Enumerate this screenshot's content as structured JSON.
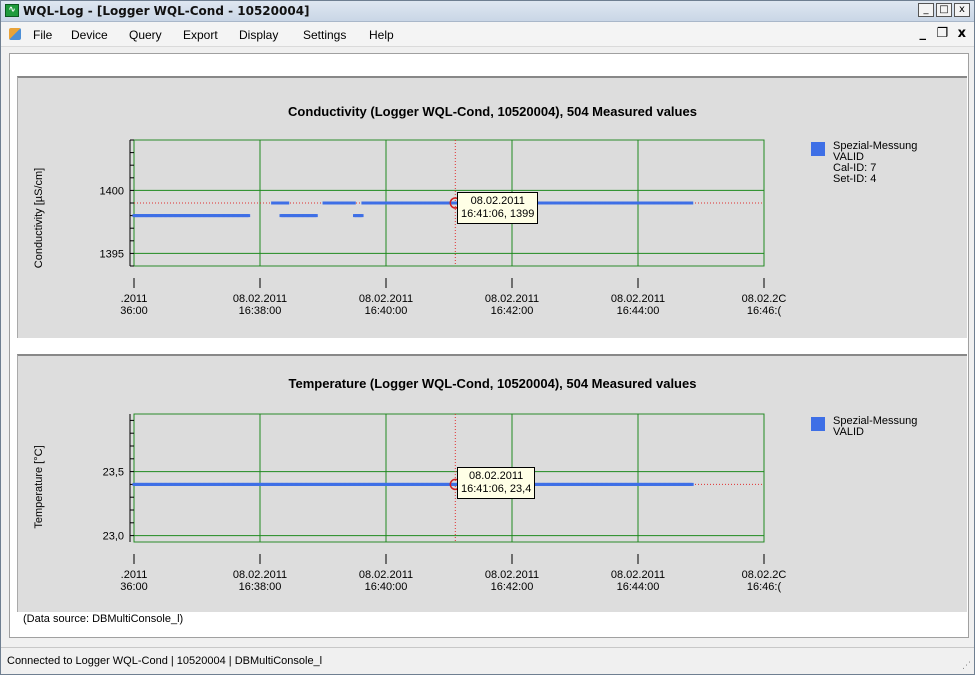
{
  "window": {
    "title": "WQL-Log - [Logger WQL-Cond - 10520004]",
    "controls": {
      "minimize": "_",
      "maximize": "□",
      "close": "x"
    },
    "mdi_controls": {
      "minimize": "_",
      "restore": "❐",
      "close": "x"
    }
  },
  "menu": {
    "items": [
      "File",
      "Device",
      "Query",
      "Export",
      "Display",
      "Settings",
      "Help"
    ]
  },
  "charts": [
    {
      "title": "Conductivity (Logger WQL-Cond, 10520004), 504 Measured values",
      "ylabel": "Conductivity [µS/cm]",
      "y_ticks": [
        "1400",
        "1395"
      ],
      "legend": {
        "name": "Spezial-Messung",
        "lines": [
          "VALID",
          "Cal-ID: 7",
          "Set-ID: 4"
        ]
      },
      "tooltip": {
        "line1": "08.02.2011",
        "line2": "16:41:06, 1399"
      }
    },
    {
      "title": "Temperature (Logger WQL-Cond, 10520004), 504 Measured values",
      "ylabel": "Temperature [°C]",
      "y_ticks": [
        "23,5",
        "23,0"
      ],
      "legend": {
        "name": "Spezial-Messung",
        "lines": [
          "VALID"
        ]
      },
      "tooltip": {
        "line1": "08.02.2011",
        "line2": "16:41:06, 23,4"
      }
    }
  ],
  "x_ticks": [
    {
      "date": ".2011",
      "time": "36:00"
    },
    {
      "date": "08.02.2011",
      "time": "16:38:00"
    },
    {
      "date": "08.02.2011",
      "time": "16:40:00"
    },
    {
      "date": "08.02.2011",
      "time": "16:42:00"
    },
    {
      "date": "08.02.2011",
      "time": "16:44:00"
    },
    {
      "date": "08.02.2C",
      "time": "16:46:("
    }
  ],
  "chart_data": [
    {
      "type": "scatter",
      "title": "Conductivity (Logger WQL-Cond, 10520004), 504 Measured values",
      "ylabel": "Conductivity [µS/cm]",
      "ylim": [
        1394,
        1404
      ],
      "x_range": [
        "16:36:00",
        "16:46:00"
      ],
      "series": [
        {
          "name": "Spezial-Messung",
          "color": "#3e6fe6",
          "segments": [
            {
              "from": "16:36:00",
              "to": "16:37:50",
              "y": 1398
            },
            {
              "from": "16:38:12",
              "to": "16:38:27",
              "y": 1399
            },
            {
              "from": "16:38:20",
              "to": "16:38:54",
              "y": 1398
            },
            {
              "from": "16:39:01",
              "to": "16:39:30",
              "y": 1399
            },
            {
              "from": "16:39:30",
              "to": "16:39:38",
              "y": 1398
            },
            {
              "from": "16:39:38",
              "to": "16:44:52",
              "y": 1399
            }
          ]
        }
      ],
      "cursor": {
        "x": "16:41:06",
        "y": 1399
      },
      "grid": true
    },
    {
      "type": "scatter",
      "title": "Temperature (Logger WQL-Cond, 10520004), 504 Measured values",
      "ylabel": "Temperature [°C]",
      "ylim": [
        22.95,
        23.95
      ],
      "x_range": [
        "16:36:00",
        "16:46:00"
      ],
      "series": [
        {
          "name": "Spezial-Messung",
          "color": "#3e6fe6",
          "segments": [
            {
              "from": "16:36:00",
              "to": "16:44:52",
              "y": 23.4
            }
          ]
        }
      ],
      "cursor": {
        "x": "16:41:06",
        "y": 23.4
      },
      "grid": true
    }
  ],
  "footer": {
    "datasource": "(Data source: DBMultiConsole_l)",
    "status": "Connected to Logger WQL-Cond  |  10520004  |  DBMultiConsole_l"
  }
}
